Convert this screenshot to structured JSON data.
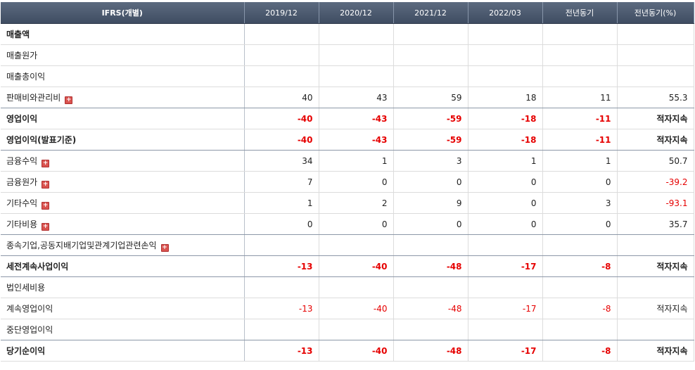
{
  "table": {
    "header": {
      "label": "IFRS(개별)",
      "columns": [
        "2019/12",
        "2020/12",
        "2021/12",
        "2022/03",
        "전년동기",
        "전년동기(%)"
      ]
    },
    "rows": [
      {
        "label": "매출액",
        "values": [
          "",
          "",
          "",
          "",
          "",
          ""
        ]
      },
      {
        "label": "매출원가",
        "values": [
          "",
          "",
          "",
          "",
          "",
          ""
        ]
      },
      {
        "label": "매출총이익",
        "values": [
          "",
          "",
          "",
          "",
          "",
          ""
        ]
      },
      {
        "label": "판매비와관리비",
        "values": [
          "40",
          "43",
          "59",
          "18",
          "11",
          "55.3"
        ]
      },
      {
        "label": "영업이익",
        "values": [
          "-40",
          "-43",
          "-59",
          "-18",
          "-11",
          "적자지속"
        ]
      },
      {
        "label": "영업이익(발표기준)",
        "values": [
          "-40",
          "-43",
          "-59",
          "-18",
          "-11",
          "적자지속"
        ]
      },
      {
        "label": "금융수익",
        "values": [
          "34",
          "1",
          "3",
          "1",
          "1",
          "50.7"
        ]
      },
      {
        "label": "금융원가",
        "values": [
          "7",
          "0",
          "0",
          "0",
          "0",
          "-39.2"
        ]
      },
      {
        "label": "기타수익",
        "values": [
          "1",
          "2",
          "9",
          "0",
          "3",
          "-93.1"
        ]
      },
      {
        "label": "기타비용",
        "values": [
          "0",
          "0",
          "0",
          "0",
          "0",
          "35.7"
        ]
      },
      {
        "label": "종속기업,공동지배기업및관계기업관련손익",
        "values": [
          "",
          "",
          "",
          "",
          "",
          ""
        ]
      },
      {
        "label": "세전계속사업이익",
        "values": [
          "-13",
          "-40",
          "-48",
          "-17",
          "-8",
          "적자지속"
        ]
      },
      {
        "label": "법인세비용",
        "values": [
          "",
          "",
          "",
          "",
          "",
          ""
        ]
      },
      {
        "label": "계속영업이익",
        "values": [
          "-13",
          "-40",
          "-48",
          "-17",
          "-8",
          "적자지속"
        ]
      },
      {
        "label": "중단영업이익",
        "values": [
          "",
          "",
          "",
          "",
          "",
          ""
        ]
      },
      {
        "label": "당기순이익",
        "values": [
          "-13",
          "-40",
          "-48",
          "-17",
          "-8",
          "적자지속"
        ]
      }
    ],
    "expand_icon": "plus-square-icon",
    "colors": {
      "negative": "#e60000",
      "header_bg": "#4a586d"
    }
  }
}
